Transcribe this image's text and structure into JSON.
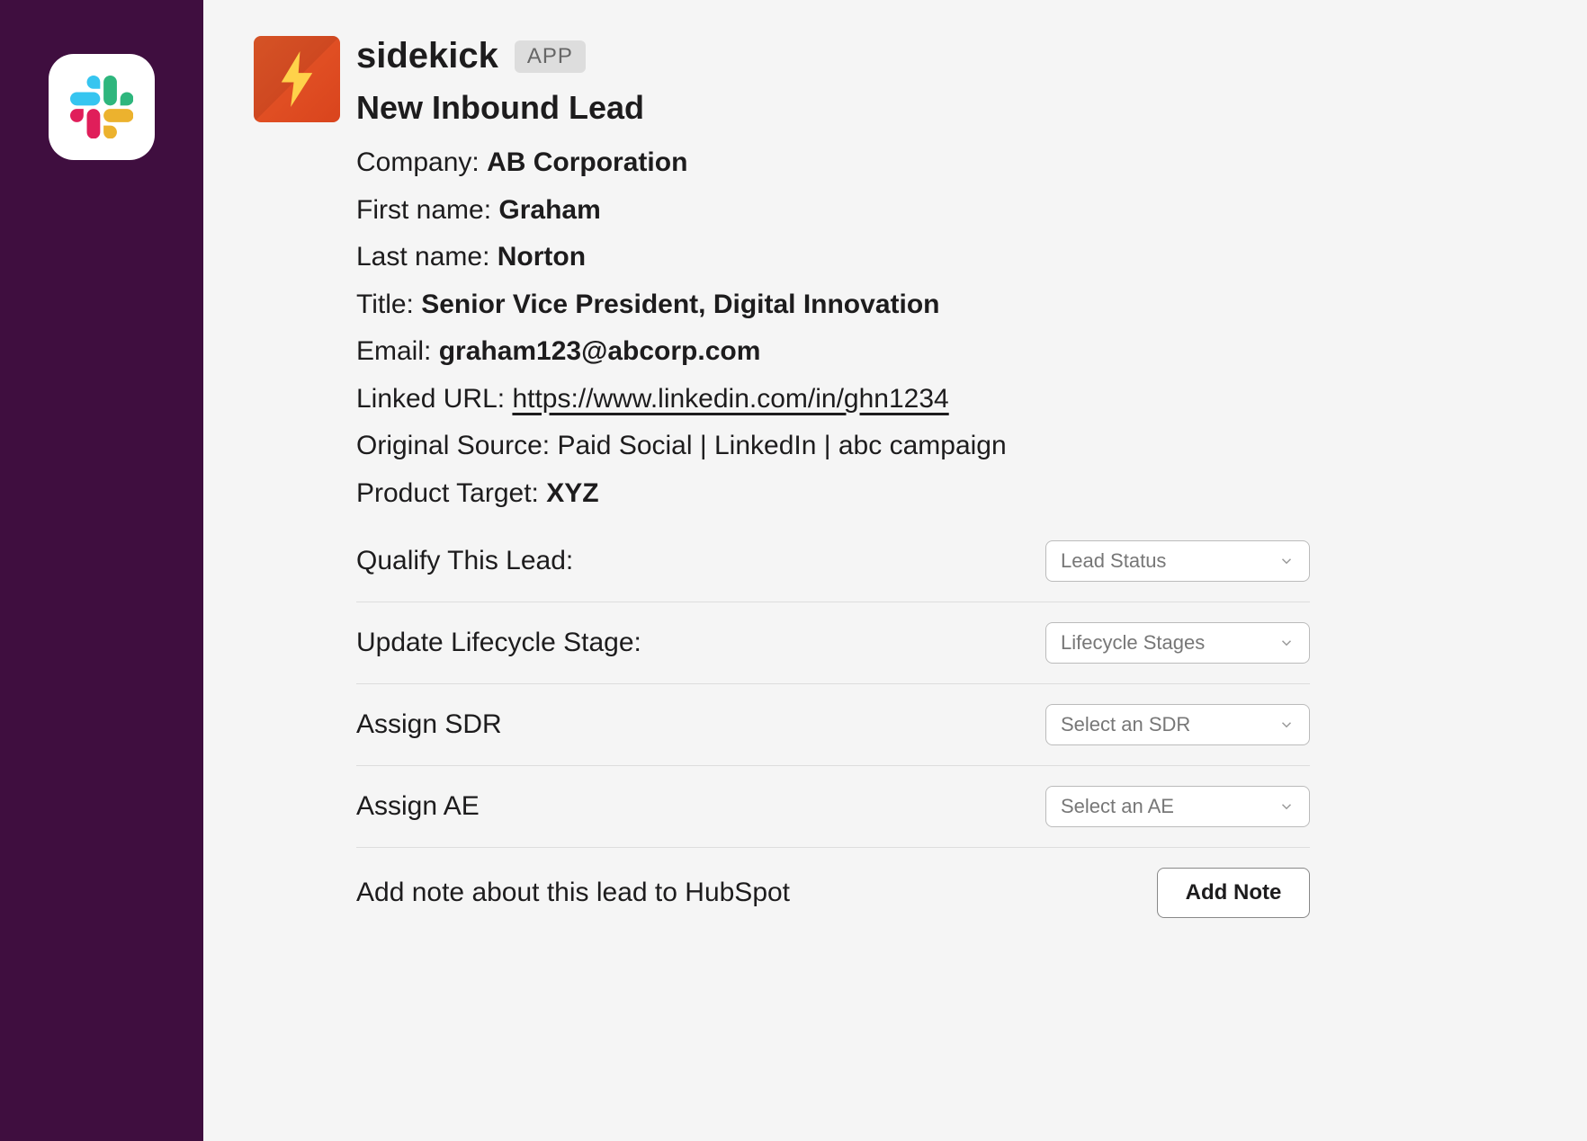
{
  "sidebar": {
    "workspace_icon_name": "slack-logo"
  },
  "message": {
    "app_name": "sidekick",
    "app_badge": "APP",
    "headline": "New Inbound Lead",
    "fields": {
      "company": {
        "label": "Company: ",
        "value": "AB Corporation"
      },
      "first_name": {
        "label": "First name: ",
        "value": "Graham"
      },
      "last_name": {
        "label": "Last name: ",
        "value": "Norton"
      },
      "title": {
        "label": "Title: ",
        "value": "Senior Vice President, Digital Innovation"
      },
      "email": {
        "label": "Email: ",
        "value": "graham123@abcorp.com"
      },
      "linked_url": {
        "label": "Linked URL: ",
        "value": "https://www.linkedin.com/in/ghn1234"
      },
      "original_source": {
        "label": "Original Source: ",
        "value": "Paid Social | LinkedIn | abc campaign"
      },
      "product_target": {
        "label": "Product Target: ",
        "value": "XYZ"
      }
    }
  },
  "actions": {
    "qualify": {
      "label": "Qualify This Lead:",
      "select_placeholder": "Lead Status"
    },
    "lifecycle": {
      "label": "Update Lifecycle Stage:",
      "select_placeholder": "Lifecycle Stages"
    },
    "sdr": {
      "label": "Assign SDR",
      "select_placeholder": "Select an SDR"
    },
    "ae": {
      "label": "Assign AE",
      "select_placeholder": "Select an AE"
    },
    "note": {
      "label": "Add note about this lead to HubSpot",
      "button_label": "Add Note"
    }
  }
}
